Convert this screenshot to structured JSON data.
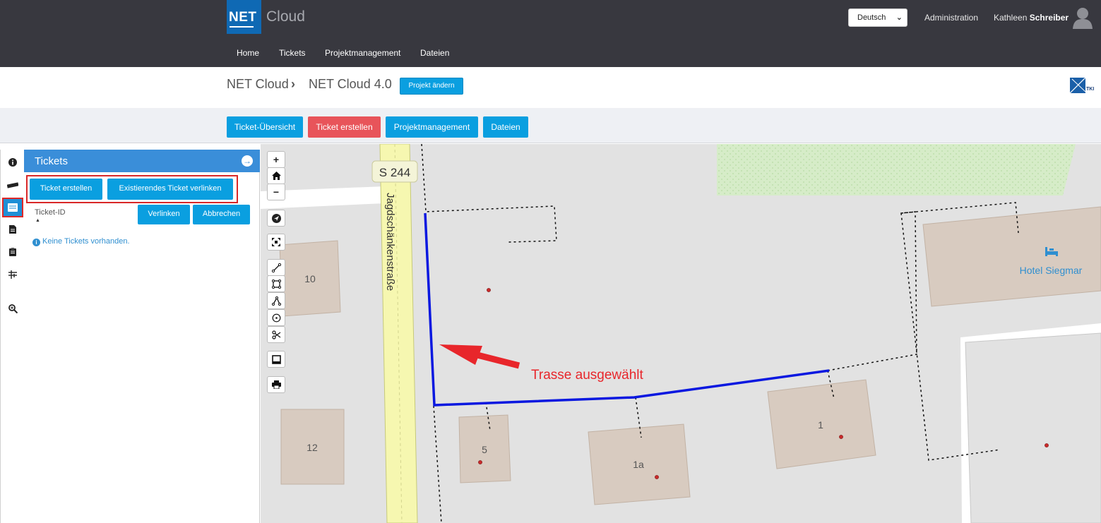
{
  "header": {
    "logo_net": "NET",
    "logo_cloud": "Cloud",
    "nav": [
      "Home",
      "Tickets",
      "Projektmanagement",
      "Dateien"
    ],
    "language": "Deutsch",
    "admin_label": "Administration",
    "user_first": "Kathleen",
    "user_last": "Schreiber"
  },
  "breadcrumb": {
    "root": "NET Cloud",
    "current": "NET Cloud 4.0",
    "change_project_label": "Projekt ändern"
  },
  "tki_logo_text": "TKI",
  "subnav": {
    "ticket_overview": "Ticket-Übersicht",
    "create_ticket": "Ticket erstellen",
    "project_management": "Projektmanagement",
    "files": "Dateien"
  },
  "rail_icons": [
    "info-icon",
    "ruler-icon",
    "tickets-icon",
    "document-icon",
    "clipboard-icon",
    "layers-adjust-icon",
    "zoom-search-icon"
  ],
  "panel": {
    "title": "Tickets",
    "create_ticket": "Ticket erstellen",
    "link_existing": "Existierendes Ticket verlinken",
    "ticket_id_label": "Ticket-ID",
    "link_button": "Verlinken",
    "cancel_button": "Abbrechen",
    "empty_message": "Keine Tickets vorhanden."
  },
  "map": {
    "road_badge": "S 244",
    "street_name": "Jagdschänkenstraße",
    "hotel_name": "Hotel Siegmar",
    "house_numbers": [
      "10",
      "12",
      "5",
      "1a",
      "1"
    ],
    "annotation": "Trasse ausgewählt",
    "annotation_color": "#e8262b",
    "route_color": "#0a18e0"
  },
  "map_tools": {
    "zoom_in": "+",
    "zoom_out": "−"
  }
}
